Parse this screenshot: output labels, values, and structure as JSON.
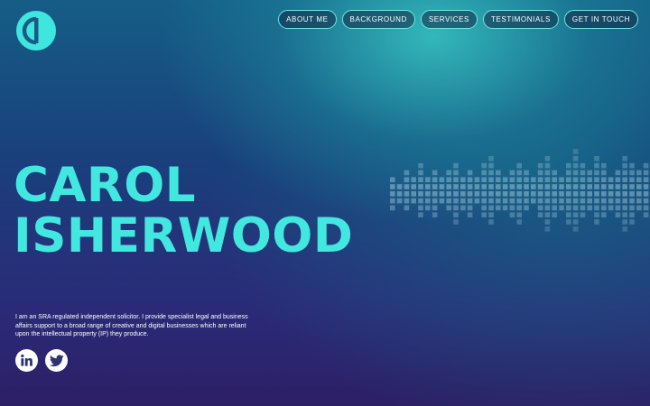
{
  "brand": {
    "logo_icon": "brand-logo-icon",
    "accent_color": "#42e8e0"
  },
  "nav": {
    "items": [
      {
        "label": "ABOUT ME"
      },
      {
        "label": "BACKGROUND"
      },
      {
        "label": "SERVICES"
      },
      {
        "label": "TESTIMONIALS"
      },
      {
        "label": "GET IN TOUCH"
      }
    ]
  },
  "hero": {
    "first_name": "CAROL",
    "last_name": "ISHERWOOD",
    "tagline": "I am an SRA regulated independent solicitor. I provide specialist legal and business affairs support to a broad range of creative and digital businesses which are reliant upon the intellectual property (IP) they produce."
  },
  "social": [
    {
      "icon": "linkedin-icon"
    },
    {
      "icon": "twitter-icon"
    }
  ],
  "decor": {
    "equalizer_icon": "sound-wave-equalizer-icon"
  }
}
